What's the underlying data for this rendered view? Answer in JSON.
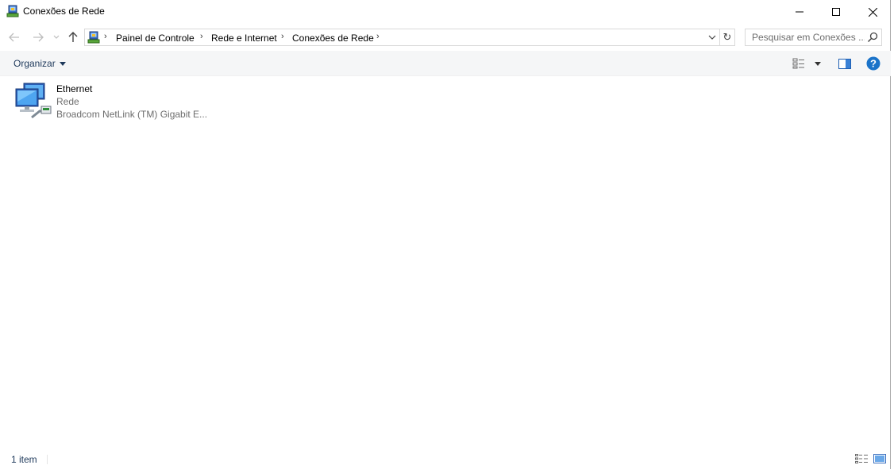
{
  "window": {
    "title": "Conexões de Rede"
  },
  "address": {
    "breadcrumbs": [
      "Painel de Controle",
      "Rede e Internet",
      "Conexões de Rede"
    ]
  },
  "search": {
    "placeholder": "Pesquisar em Conexões ..."
  },
  "toolbar": {
    "organize_label": "Organizar"
  },
  "items": [
    {
      "name": "Ethernet",
      "status": "Rede",
      "device": "Broadcom NetLink (TM) Gigabit E...",
      "icon": "network-adapter-icon"
    }
  ],
  "statusbar": {
    "count_text": "1 item"
  },
  "colors": {
    "accent": "#1e395b",
    "secondary_text": "#6d6d6d",
    "help_blue": "#1a73c9",
    "command_bar_bg": "#f5f6f7"
  }
}
